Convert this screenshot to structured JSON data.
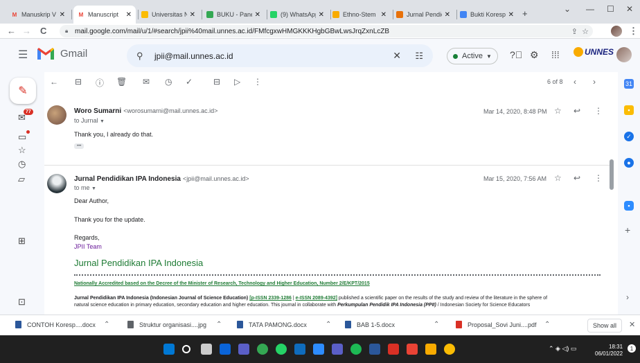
{
  "browser": {
    "tabs": [
      {
        "title": "Manuskrip V",
        "fav": "M",
        "color": "#ea4335"
      },
      {
        "title": "Manuscript",
        "fav": "M",
        "color": "#ea4335",
        "active": true
      },
      {
        "title": "Universitas N",
        "fav": "",
        "color": "#fbbc04"
      },
      {
        "title": "BUKU - Pane",
        "fav": "",
        "color": "#34a853"
      },
      {
        "title": "(9) WhatsApp",
        "fav": "",
        "color": "#25d366"
      },
      {
        "title": "Ethno-Stem",
        "fav": "",
        "color": "#f9ab00"
      },
      {
        "title": "Jurnal Pendidi",
        "fav": "",
        "color": "#e8710a"
      },
      {
        "title": "Bukti Koresp",
        "fav": "",
        "color": "#4285f4"
      }
    ],
    "new_tab": "+",
    "url": "mail.google.com/mail/u/1/#search/jpii%40mail.unnes.ac.id/FMfcgxwHMGKKKHgbGBwLwsJrqZxnLcZB"
  },
  "gmail": {
    "logo_text": "Gmail",
    "search_value": "jpii@mail.unnes.ac.id",
    "status": "Active",
    "org_logo": "UNNES",
    "compose_badge": "77",
    "pagination": "6 of 8"
  },
  "messages": [
    {
      "sender": "Woro Sumarni",
      "email": "<worosumarni@mail.unnes.ac.id>",
      "to": "to Jurnal",
      "date": "Mar 14, 2020, 8:48 PM",
      "body": "Thank you, I already do that.",
      "ellipsis": "•••"
    },
    {
      "sender": "Jurnal Pendidikan IPA Indonesia",
      "email": "<jpii@mail.unnes.ac.id>",
      "to": "to me",
      "date": "Mar 15, 2020, 7:56 AM",
      "greeting": "Dear Author,",
      "line1": "Thank you for the update.",
      "regards": "Regards,",
      "team": "JPII Team",
      "signature_title": "Jurnal Pendidikan IPA Indonesia",
      "accreditation": "Nationally Accredited based on the Decree of the Minister of Research, Technology and Higher Education, Number 2/E/KPT/2015",
      "desc_bold": "Jurnal Pendidikan IPA Indonesia (Indonesian Journal of Science Education)",
      "pissn": "[p-ISSN 2339-1286",
      "eissn": "e-ISSN 2089-4392]",
      "desc_rest1": "published a scientific paper on the results of the study and review of the literature in the sphere of",
      "desc_line2a": "natural science education in primary education, secondary education and higher education. This journal in collaborate with",
      "desc_line2b": "Perkumpulan Pendidik IPA Indonesia (PPII)",
      "desc_line2c": "/ Indonesian Society for Science Educators"
    }
  ],
  "downloads": [
    {
      "name": "CONTOH Koresp....docx",
      "color": "#2b579a"
    },
    {
      "name": "Struktur organisasi....jpg",
      "color": "#5f6368"
    },
    {
      "name": "TATA PAMONG.docx",
      "color": "#2b579a"
    },
    {
      "name": "BAB 1-5.docx",
      "color": "#2b579a"
    },
    {
      "name": "Proposal_Sovi Juni....pdf",
      "color": "#d93025"
    }
  ],
  "show_all": "Show all",
  "taskbar": {
    "time": "18:31",
    "date": "06/01/2022"
  }
}
